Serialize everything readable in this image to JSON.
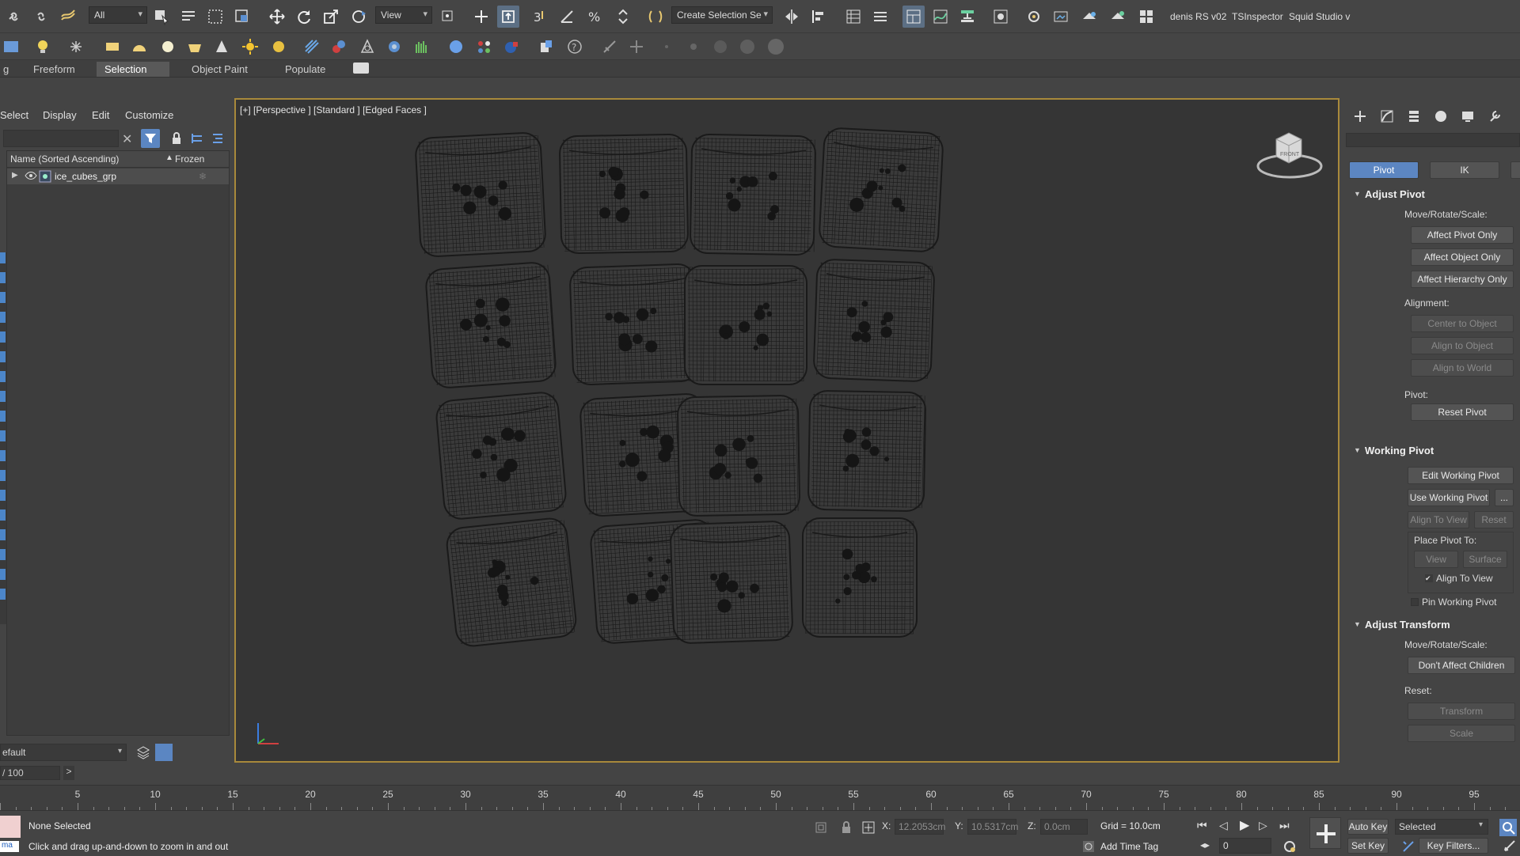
{
  "toolbar": {
    "selection_filter": "All",
    "ref_coord": "View",
    "named_selection": "Create Selection Se",
    "scripts": [
      "denis RS v02",
      "TSInspector",
      "Squid Studio v"
    ]
  },
  "ribbon": {
    "tabs": [
      "g",
      "Freeform",
      "Selection",
      "Object Paint",
      "Populate"
    ],
    "active_tab": "Selection"
  },
  "explorer": {
    "menu": [
      "Select",
      "Display",
      "Edit",
      "Customize"
    ],
    "columns": {
      "name": "Name (Sorted Ascending)",
      "sort_arrow": "▲",
      "frozen": "Frozen"
    },
    "rows": [
      {
        "name": "ice_cubes_grp",
        "frozen_icon": "❄"
      }
    ],
    "layer": "efault",
    "frame_counter": "/ 100",
    "frame_next": ">"
  },
  "viewport": {
    "label": "[+] [Perspective ] [Standard ] [Edged Faces ]",
    "cube_grid": {
      "rows": 4,
      "cols": 4
    },
    "viewcube_label": "FRONT"
  },
  "command_panel": {
    "subtabs": [
      "Pivot",
      "IK",
      ""
    ],
    "active_subtab": "Pivot",
    "adjust_pivot": {
      "title": "Adjust Pivot",
      "move_label": "Move/Rotate/Scale:",
      "buttons": [
        "Affect Pivot Only",
        "Affect Object Only",
        "Affect Hierarchy Only"
      ],
      "alignment_label": "Alignment:",
      "alignment_buttons": [
        "Center to Object",
        "Align to Object",
        "Align to World"
      ],
      "pivot_label": "Pivot:",
      "reset_pivot": "Reset Pivot"
    },
    "working_pivot": {
      "title": "Working Pivot",
      "edit": "Edit Working Pivot",
      "use": "Use Working Pivot",
      "use_more": "...",
      "align_to_view": "Align To View",
      "reset": "Reset",
      "place_label": "Place Pivot To:",
      "view": "View",
      "surface": "Surface",
      "align_check": "Align To View",
      "align_check_state": "✔",
      "pin": "Pin Working Pivot"
    },
    "adjust_transform": {
      "title": "Adjust Transform",
      "move_label": "Move/Rotate/Scale:",
      "dont_affect": "Don't Affect Children",
      "reset_label": "Reset:",
      "transform": "Transform",
      "scale": "Scale"
    }
  },
  "timeline": {
    "ticks": [
      "5",
      "10",
      "15",
      "20",
      "25",
      "30",
      "35",
      "40",
      "45",
      "50",
      "55",
      "60",
      "65",
      "70",
      "75",
      "80",
      "85",
      "90",
      "95"
    ]
  },
  "status": {
    "selection": "None Selected",
    "prompt": "Click and drag up-and-down to zoom in and out",
    "maxscript": "ma",
    "x_label": "X:",
    "x_value": "12.2053cm",
    "y_label": "Y:",
    "y_value": "10.5317cm",
    "z_label": "Z:",
    "z_value": "0.0cm",
    "grid": "Grid = 10.0cm",
    "add_time_tag": "Add Time Tag",
    "auto_key": "Auto Key",
    "set_key": "Set Key",
    "key_mode": "Selected",
    "key_filters": "Key Filters...",
    "frame": "0"
  },
  "colors": {
    "viewport_border": "#a8893b",
    "active_subtab": "#5c86c2",
    "wire": "#1a1a1a"
  }
}
